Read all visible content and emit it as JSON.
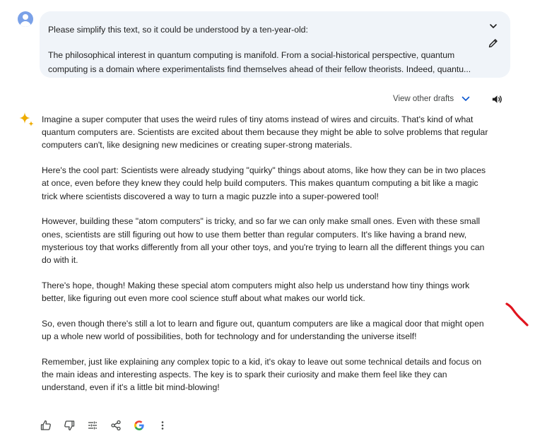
{
  "prompt": {
    "line1": "Please simplify this text, so it could be understood by a ten-year-old:",
    "line2": "The philosophical interest in quantum computing is manifold. From a social-historical perspective, quantum computing is a domain where experimentalists find themselves ahead of their fellow theorists. Indeed, quantu..."
  },
  "drafts": {
    "label": "View other drafts"
  },
  "response": {
    "paragraphs": [
      "Imagine a super computer that uses the weird rules of tiny atoms instead of wires and circuits. That's kind of what quantum computers are. Scientists are excited about them because they might be able to solve problems that regular computers can't, like designing new medicines or creating super-strong materials.",
      "Here's the cool part: Scientists were already studying \"quirky\" things about atoms, like how they can be in two places at once, even before they knew they could help build computers. This makes quantum computing a bit like a magic trick where scientists discovered a way to turn a magic puzzle into a super-powered tool!",
      "However, building these \"atom computers\" is tricky, and so far we can only make small ones. Even with these small ones, scientists are still figuring out how to use them better than regular computers. It's like having a brand new, mysterious toy that works differently from all your other toys, and you're trying to learn all the different things you can do with it.",
      "There's hope, though! Making these special atom computers might also help us understand how tiny things work better, like figuring out even more cool science stuff about what makes our world tick.",
      "So, even though there's still a lot to learn and figure out, quantum computers are like a magical door that might open up a whole new world of possibilities, both for technology and for understanding the universe itself!",
      "Remember, just like explaining any complex topic to a kid, it's okay to leave out some technical details and focus on the main ideas and interesting aspects. The key is to spark their curiosity and make them feel like they can understand, even if it's a little bit mind-blowing!"
    ]
  },
  "icons": {
    "avatar": "user-avatar-icon",
    "expand": "chevron-down-icon",
    "edit": "pencil-icon",
    "drafts_chevron": "chevron-down-icon",
    "listen": "speaker-icon",
    "assistant": "sparkle-icon",
    "toolbar": [
      "thumbs-up-icon",
      "thumbs-down-icon",
      "tune-icon",
      "share-icon",
      "google-g-icon",
      "more-vert-icon"
    ]
  },
  "colors": {
    "prompt_bg": "#f0f4f9",
    "link_blue": "#0b57d0",
    "text": "#1f1f1f",
    "secondary_text": "#444746",
    "pen_mark": "#e0141e"
  }
}
